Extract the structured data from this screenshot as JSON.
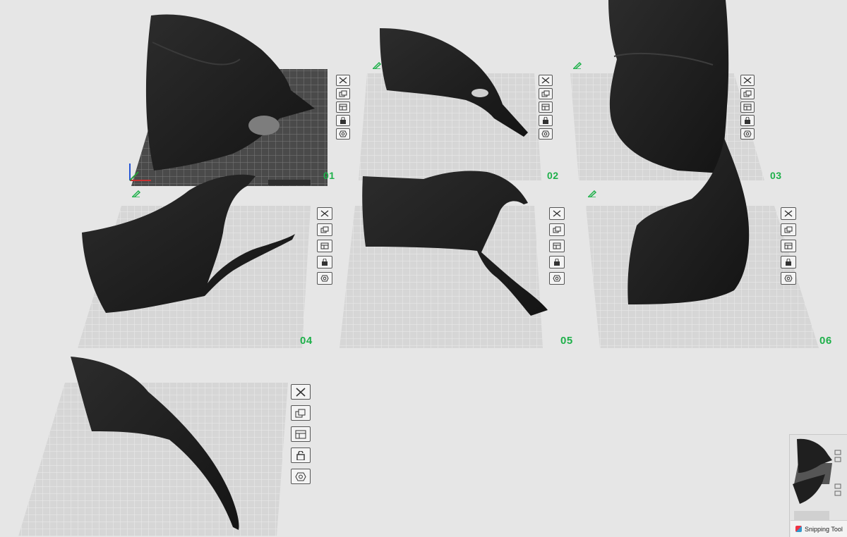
{
  "plates": [
    {
      "label": "01"
    },
    {
      "label": "02"
    },
    {
      "label": "03"
    },
    {
      "label": "04"
    },
    {
      "label": "05"
    },
    {
      "label": "06"
    },
    {
      "label": ""
    }
  ],
  "plate_tools": [
    "close-icon",
    "arrange-icon",
    "layers-icon",
    "lock-icon",
    "settings-icon"
  ],
  "taskbar": {
    "app_label": "Snipping Tool"
  },
  "colors": {
    "accent": "#1eb04a",
    "plate": "#d9d9d9",
    "active_plate": "#4a4a4a",
    "model": "#1f1f1f"
  }
}
